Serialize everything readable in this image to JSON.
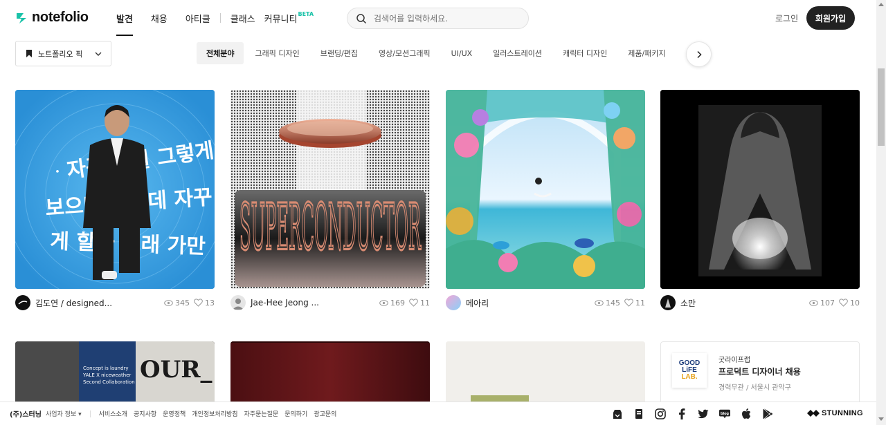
{
  "brand": {
    "logo_text": "notefolio",
    "accent": "#19c2a8"
  },
  "nav": {
    "items": [
      {
        "label": "발견",
        "active": true
      },
      {
        "label": "채용",
        "active": false
      },
      {
        "label": "아티클",
        "active": false
      },
      {
        "label": "클래스",
        "active": false
      },
      {
        "label": "커뮤니티",
        "active": false,
        "badge": "BETA"
      }
    ]
  },
  "search": {
    "placeholder": "검색어를 입력하세요."
  },
  "auth": {
    "login": "로그인",
    "signup": "회원가입"
  },
  "picks": {
    "label": "노트폴리오 픽"
  },
  "categories": [
    "전체분야",
    "그래픽 디자인",
    "브랜딩/편집",
    "영상/모션그래픽",
    "UI/UX",
    "일러스트레이션",
    "캐릭터 디자인",
    "제품/패키지"
  ],
  "cards": [
    {
      "author": "김도연 / designed...",
      "views": "345",
      "likes": "13",
      "thumb_icon": "portrait-typography-artwork",
      "bg": "#2f9be0"
    },
    {
      "author": "Jae-Hee Jeong ...",
      "views": "169",
      "likes": "11",
      "thumb_icon": "superconductor-typography-artwork",
      "bg": "#d9d9d9"
    },
    {
      "author": "메아리",
      "views": "145",
      "likes": "11",
      "thumb_icon": "tropical-underwater-illustration",
      "bg": "#8fd3e8"
    },
    {
      "author": "소만",
      "views": "107",
      "likes": "10",
      "thumb_icon": "book-cover-ghost-figure",
      "bg": "#000000"
    }
  ],
  "row2": [
    {
      "thumb_icon": "brand-campaign-photo",
      "caption_lines": [
        "Concept is laundry",
        "YALE X niceweather",
        "Second Collaboration"
      ],
      "big_text": "OUR_"
    },
    {
      "thumb_icon": "dark-red-curtain-artwork"
    },
    {
      "thumb_icon": "product-photo-light"
    }
  ],
  "ad": {
    "company": "굿라이프랩",
    "title": "프로덕트 디자이너 채용",
    "sub": "경력무관 / 서울시 관악구",
    "logo_lines": [
      "GOOD",
      "LiFE",
      "LAB."
    ]
  },
  "footer": {
    "company": "(주)스터닝",
    "bizinfo": "사업자 정보",
    "links": [
      "서비스소개",
      "공지사항",
      "운영정책",
      "개인정보처리방침",
      "자주묻는질문",
      "문의하기",
      "광고문의"
    ],
    "icons": [
      "store-icon",
      "notebook-icon",
      "instagram-icon",
      "facebook-icon",
      "twitter-icon",
      "blog-icon",
      "apple-icon",
      "google-play-icon"
    ],
    "stunning": "STUNNING"
  }
}
